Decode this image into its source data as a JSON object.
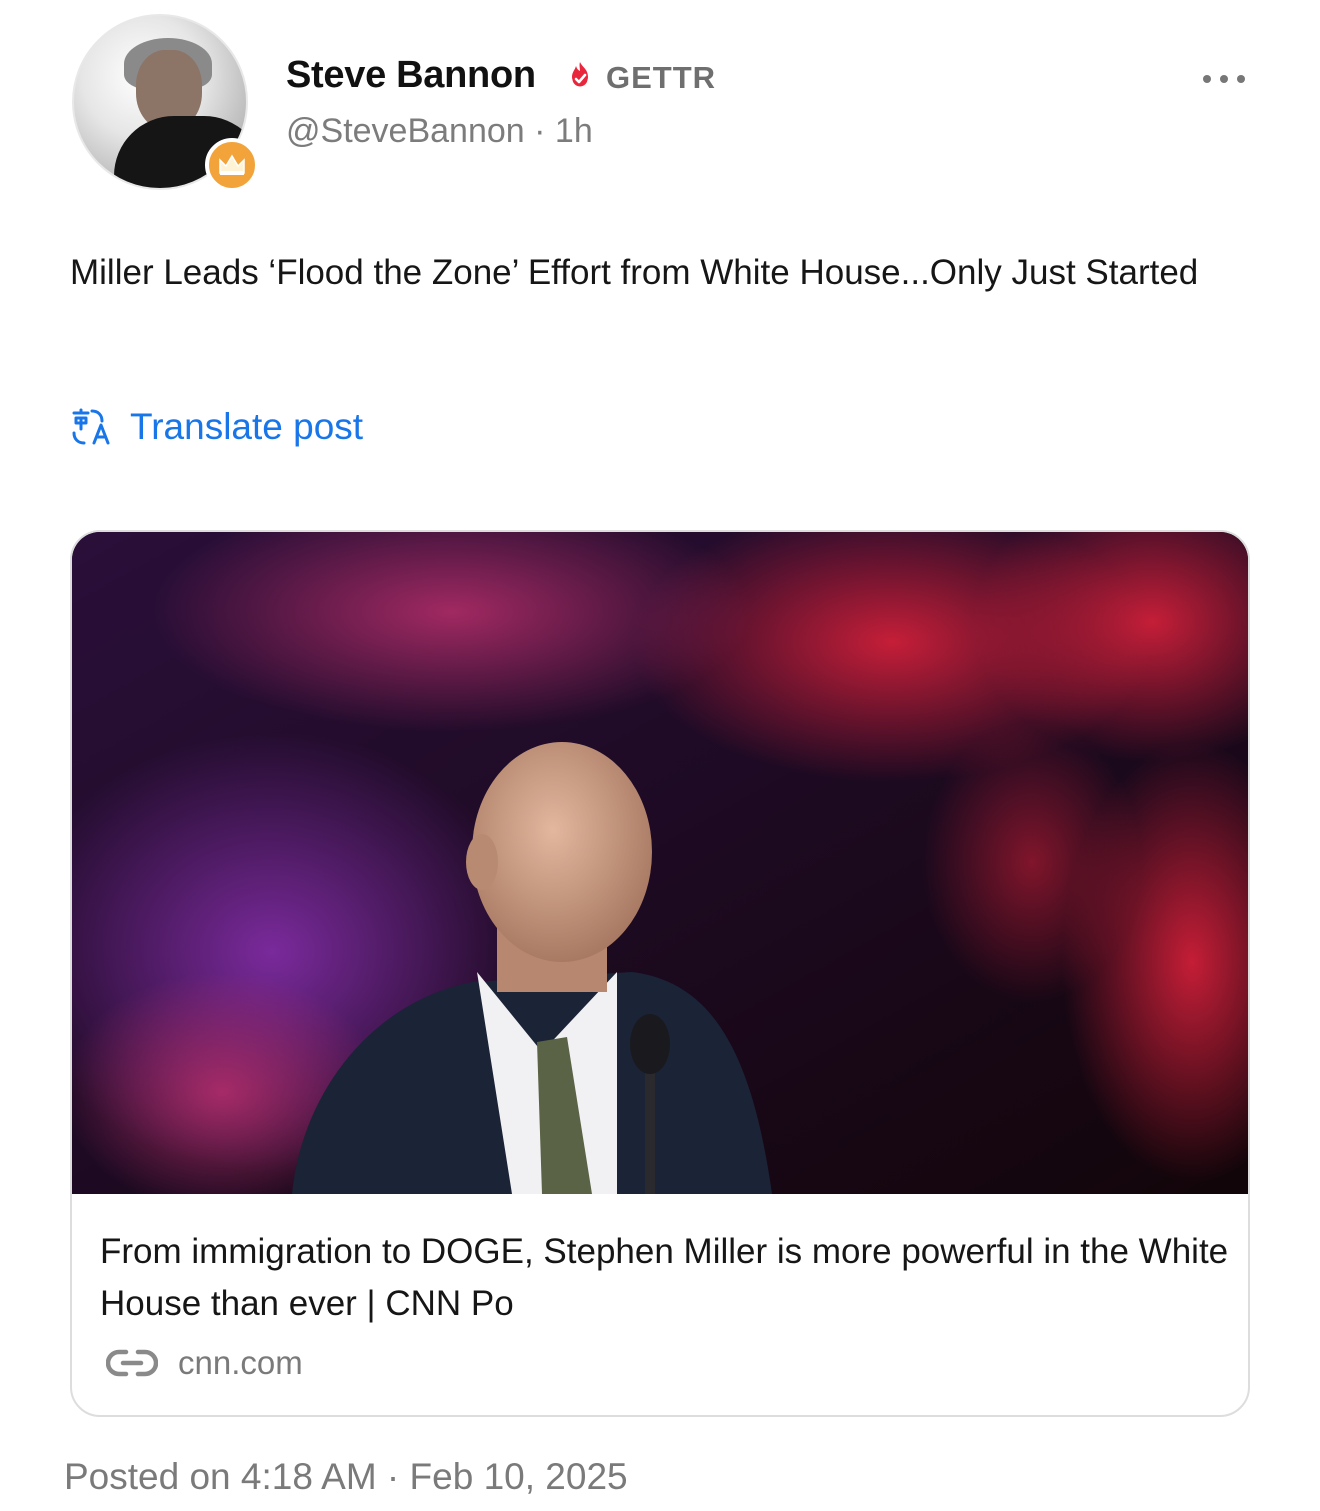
{
  "post": {
    "author": {
      "display_name": "Steve Bannon",
      "platform_label": "GETTR",
      "handle": "@SteveBannon",
      "age": "1h",
      "avatar_icon": "avatar-photo",
      "badge_icon": "crown-icon",
      "verified_icon": "verified-flame-icon"
    },
    "more_icon": "more-horizontal-icon",
    "text": "Miller Leads ‘Flood the Zone’ Effort from White House...Only Just Started",
    "translate": {
      "icon": "translate-icon",
      "label": "Translate post"
    },
    "link_card": {
      "title": "From immigration to DOGE, Stephen Miller is more powerful in the White House than ever | CNN Po",
      "domain": "cnn.com",
      "link_icon": "link-icon"
    },
    "posted_on": "Posted on 4:18 AM · Feb 10, 2025"
  },
  "colors": {
    "accent": "#1976e8",
    "verified": "#e8263c",
    "badge": "#f2a33a",
    "muted_text": "#7a7a7a"
  }
}
